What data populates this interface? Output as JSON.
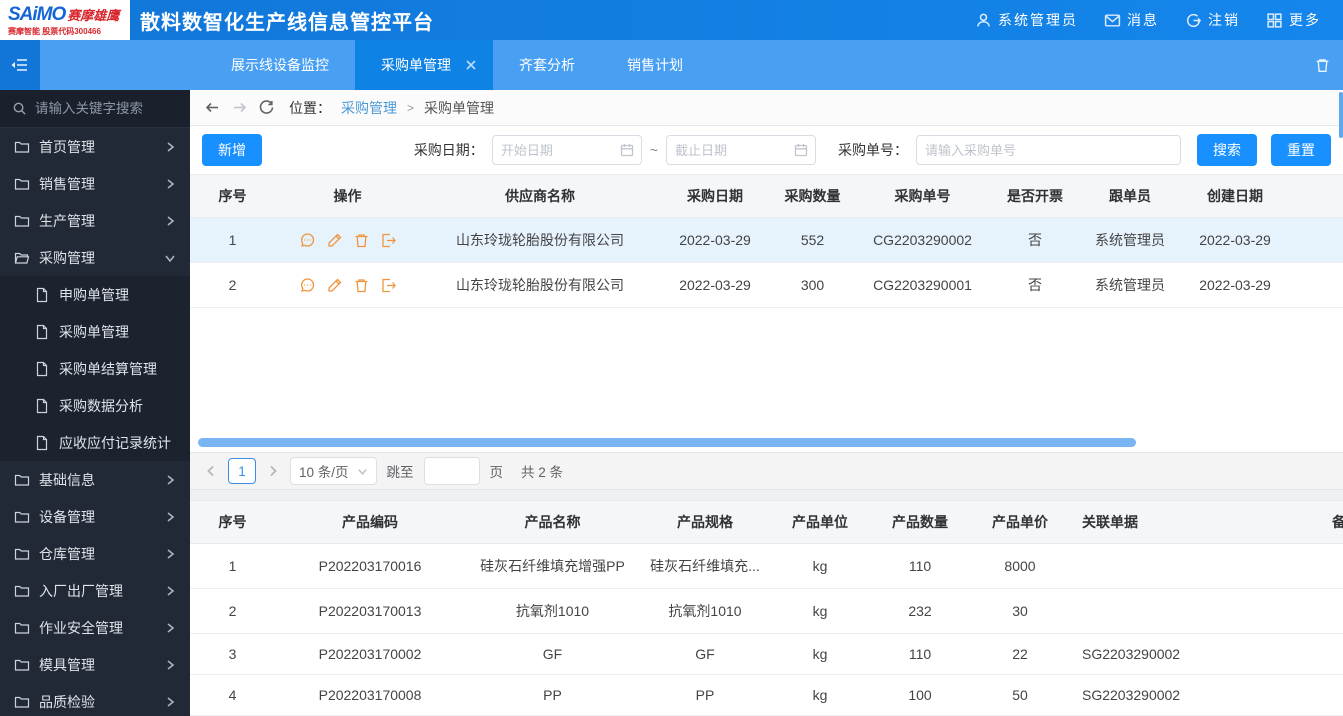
{
  "header": {
    "logo": {
      "brand": "SAiMO",
      "brand_suffix": "赛摩雄鹰",
      "subtitle": "赛摩智能 股票代码300466"
    },
    "title": "散料数智化生产线信息管控平台",
    "user_label": "系统管理员",
    "messages_label": "消息",
    "logout_label": "注销",
    "more_label": "更多"
  },
  "tabs": {
    "items": [
      {
        "label": "展示线设备监控",
        "active": false
      },
      {
        "label": "采购单管理",
        "active": true,
        "closable": true
      },
      {
        "label": "齐套分析",
        "active": false
      },
      {
        "label": "销售计划",
        "active": false
      }
    ]
  },
  "sidebar": {
    "search_placeholder": "请输入关键字搜索",
    "items": [
      {
        "label": "首页管理",
        "icon": "folder-icon",
        "chevron": "right"
      },
      {
        "label": "销售管理",
        "icon": "folder-icon",
        "chevron": "right"
      },
      {
        "label": "生产管理",
        "icon": "folder-icon",
        "chevron": "right"
      },
      {
        "label": "采购管理",
        "icon": "folder-open-icon",
        "chevron": "down"
      },
      {
        "label": "申购单管理",
        "icon": "file-icon",
        "sub": true
      },
      {
        "label": "采购单管理",
        "icon": "file-icon",
        "sub": true
      },
      {
        "label": "采购单结算管理",
        "icon": "file-icon",
        "sub": true
      },
      {
        "label": "采购数据分析",
        "icon": "file-icon",
        "sub": true
      },
      {
        "label": "应收应付记录统计",
        "icon": "file-icon",
        "sub": true
      },
      {
        "label": "基础信息",
        "icon": "folder-icon",
        "chevron": "right"
      },
      {
        "label": "设备管理",
        "icon": "folder-icon",
        "chevron": "right"
      },
      {
        "label": "仓库管理",
        "icon": "folder-icon",
        "chevron": "right"
      },
      {
        "label": "入厂出厂管理",
        "icon": "folder-icon",
        "chevron": "right"
      },
      {
        "label": "作业安全管理",
        "icon": "folder-icon",
        "chevron": "right"
      },
      {
        "label": "模具管理",
        "icon": "folder-icon",
        "chevron": "right"
      },
      {
        "label": "品质检验",
        "icon": "folder-icon",
        "chevron": "right"
      }
    ]
  },
  "breadcrumb": {
    "prefix": "位置：",
    "parent": "采购管理",
    "separator": ">",
    "current": "采购单管理"
  },
  "toolbar": {
    "add_label": "新增",
    "purchase_date_label": "采购日期：",
    "start_placeholder": "开始日期",
    "range_separator": "~",
    "end_placeholder": "截止日期",
    "order_no_label": "采购单号：",
    "order_no_placeholder": "请输入采购单号",
    "search_label": "搜索",
    "reset_label": "重置"
  },
  "orders_table": {
    "columns": [
      "序号",
      "操作",
      "供应商名称",
      "采购日期",
      "采购数量",
      "采购单号",
      "是否开票",
      "跟单员",
      "创建日期"
    ],
    "action_icons": [
      "comment-icon",
      "edit-icon",
      "delete-icon",
      "export-icon"
    ],
    "rows": [
      {
        "index": "1",
        "supplier": "山东玲珑轮胎股份有限公司",
        "date": "2022-03-29",
        "qty": "552",
        "order_no": "CG2203290002",
        "invoiced": "否",
        "follower": "系统管理员",
        "created": "2022-03-29",
        "selected": true
      },
      {
        "index": "2",
        "supplier": "山东玲珑轮胎股份有限公司",
        "date": "2022-03-29",
        "qty": "300",
        "order_no": "CG2203290001",
        "invoiced": "否",
        "follower": "系统管理员",
        "created": "2022-03-29",
        "selected": false
      }
    ]
  },
  "pagination": {
    "current_page": "1",
    "page_size": "10 条/页",
    "jump_label": "跳至",
    "page_unit_label": "页",
    "total_label": "共 2 条"
  },
  "products_table": {
    "columns": [
      "序号",
      "产品编码",
      "产品名称",
      "产品规格",
      "产品单位",
      "产品数量",
      "产品单价",
      "关联单据",
      "备"
    ],
    "rows": [
      {
        "index": "1",
        "code": "P202203170016",
        "name": "硅灰石纤维填充增强PP",
        "spec": "硅灰石纤维填充...",
        "unit": "kg",
        "qty": "110",
        "price": "8000",
        "related": ""
      },
      {
        "index": "2",
        "code": "P202203170013",
        "name": "抗氧剂1010",
        "spec": "抗氧剂1010",
        "unit": "kg",
        "qty": "232",
        "price": "30",
        "related": ""
      },
      {
        "index": "3",
        "code": "P202203170002",
        "name": "GF",
        "spec": "GF",
        "unit": "kg",
        "qty": "110",
        "price": "22",
        "related": "SG2203290002"
      },
      {
        "index": "4",
        "code": "P202203170008",
        "name": "PP",
        "spec": "PP",
        "unit": "kg",
        "qty": "100",
        "price": "50",
        "related": "SG2203290002"
      }
    ]
  },
  "colors": {
    "accent": "#1890ff",
    "header_blue": "#1176d8",
    "tabbar_blue": "#49a0f3",
    "active_tab_blue": "#0f82e6",
    "sidebar_bg": "#212836",
    "action_icon_orange": "#f0953f",
    "selected_row_bg": "#e6f2fc",
    "scrollbar_thumb": "#79b5f2",
    "brand_red": "#d8262c"
  }
}
